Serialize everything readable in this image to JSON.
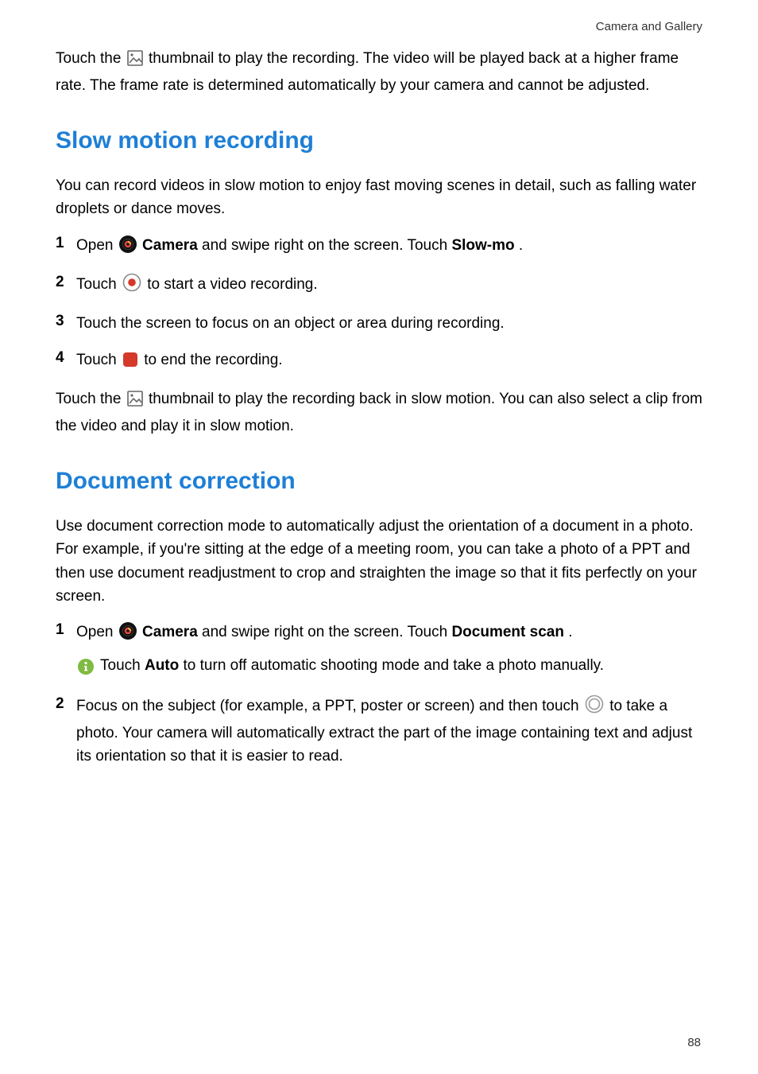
{
  "header": {
    "label": "Camera and Gallery"
  },
  "footer": {
    "page": "88"
  },
  "intro": {
    "line1a": "Touch the ",
    "line1b": " thumbnail to play the recording. The video will be played back at a higher frame rate. The frame rate is determined automatically by your camera and cannot be adjusted."
  },
  "section1": {
    "title": "Slow motion recording",
    "intro": "You can record videos in slow motion to enjoy fast moving scenes in detail, such as falling water droplets or dance moves.",
    "steps": [
      {
        "n": "1",
        "a": "Open ",
        "b": " ",
        "label": "Camera",
        "c": " and swipe right on the screen. Touch ",
        "bold2": "Slow-mo",
        "d": "."
      },
      {
        "n": "2",
        "a": "Touch ",
        "b": " to start a video recording."
      },
      {
        "n": "3",
        "a": "Touch the screen to focus on an object or area during recording."
      },
      {
        "n": "4",
        "a": "Touch ",
        "b": " to end the recording."
      }
    ],
    "outro_a": "Touch the ",
    "outro_b": " thumbnail to play the recording back in slow motion. You can also select a clip from the video and play it in slow motion."
  },
  "section2": {
    "title": "Document correction",
    "intro": "Use document correction mode to automatically adjust the orientation of a document in a photo. For example, if you're sitting at the edge of a meeting room, you can take a photo of a PPT and then use document readjustment to crop and straighten the image so that it fits perfectly on your screen.",
    "steps": {
      "s1_n": "1",
      "s1_a": "Open ",
      "s1_label": "Camera",
      "s1_b": " and swipe right on the screen. Touch ",
      "s1_bold2": "Document scan",
      "s1_c": ".",
      "s1_info_a": "Touch ",
      "s1_info_bold": "Auto",
      "s1_info_b": " to turn off automatic shooting mode and take a photo manually.",
      "s2_n": "2",
      "s2_a": "Focus on the subject (for example, a PPT, poster or screen) and then touch ",
      "s2_b": " to take a photo. Your camera will automatically extract the part of the image containing text and adjust its orientation so that it is easier to read."
    }
  }
}
